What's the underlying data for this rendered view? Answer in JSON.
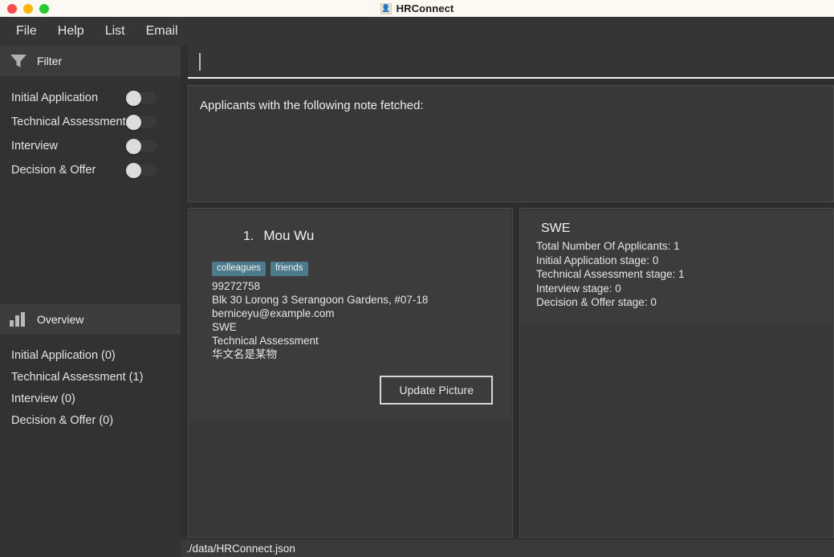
{
  "window": {
    "title": "HRConnect",
    "title_icon": "person-icon",
    "traffic_lights": [
      {
        "name": "close",
        "color": "#fc4b4b"
      },
      {
        "name": "minimize",
        "color": "#ffb508"
      },
      {
        "name": "maximize",
        "color": "#23cc30"
      }
    ]
  },
  "menubar": {
    "items": [
      {
        "label": "File"
      },
      {
        "label": "Help"
      },
      {
        "label": "List"
      },
      {
        "label": "Email"
      }
    ]
  },
  "sidebar": {
    "filter": {
      "icon": "funnel-icon",
      "header": "Filter",
      "items": [
        {
          "label": "Initial Application",
          "toggle": "off"
        },
        {
          "label": "Technical Assessment",
          "toggle": "off"
        },
        {
          "label": "Interview",
          "toggle": "off"
        },
        {
          "label": "Decision & Offer",
          "toggle": "off"
        }
      ]
    },
    "overview": {
      "icon": "bar-chart-icon",
      "header": "Overview",
      "items": [
        {
          "label": "Initial Application (0)"
        },
        {
          "label": "Technical Assessment (1)"
        },
        {
          "label": "Interview (0)"
        },
        {
          "label": "Decision & Offer (0)"
        }
      ]
    }
  },
  "command": {
    "value": "",
    "placeholder": ""
  },
  "result": {
    "message": "Applicants with the following note fetched:"
  },
  "applicants": [
    {
      "index": "1.",
      "name": "Mou Wu",
      "tags": [
        "colleagues",
        "friends"
      ],
      "phone": "99272758",
      "address": "Blk 30 Lorong 3 Serangoon Gardens, #07-18",
      "email": "berniceyu@example.com",
      "role": "SWE",
      "stage": "Technical Assessment",
      "note": "华文名是某物",
      "button_label": "Update Picture"
    }
  ],
  "stats": {
    "title": "SWE",
    "lines": [
      "Total Number Of Applicants: 1",
      "Initial Application stage: 0",
      "Technical Assessment stage: 1",
      "Interview stage: 0",
      "Decision & Offer stage: 0"
    ]
  },
  "statusbar": {
    "path": "./data/HRConnect.json"
  },
  "colors": {
    "titlebar_bg": "#fbf9f2",
    "menubar_bg": "#353535",
    "sidebar_bg": "#323232",
    "panel_header_bg": "#3c3c3c",
    "main_bg": "#2e2e2e",
    "card_bg": "#3c3c3c",
    "chip_bg": "#4c7c8c",
    "text_primary": "#e6e6e6"
  }
}
